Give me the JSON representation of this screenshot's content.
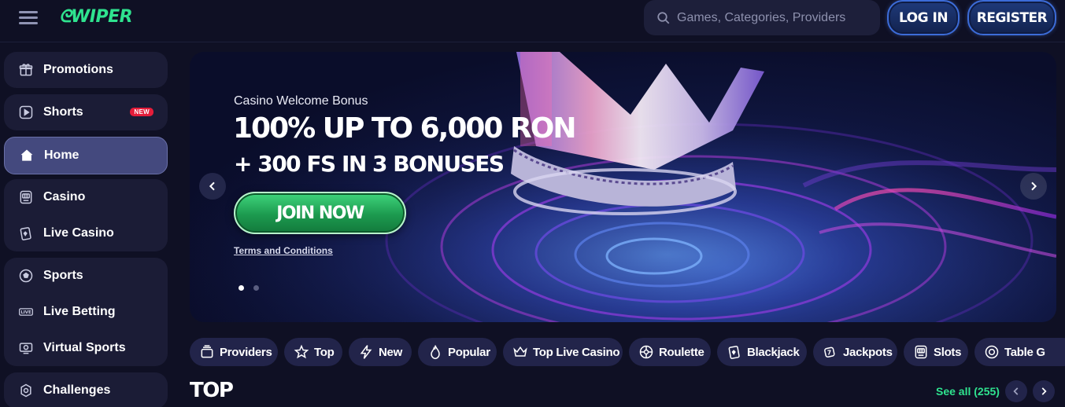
{
  "header": {
    "logo_text": "ᘓWIPER",
    "search_placeholder": "Games, Categories, Providers",
    "login_label": "LOG IN",
    "register_label": "REGISTER"
  },
  "sidebar": {
    "groups": [
      {
        "items": [
          {
            "label": "Promotions",
            "icon": "gift-icon"
          }
        ]
      },
      {
        "items": [
          {
            "label": "Shorts",
            "icon": "play-icon",
            "badge": "NEW"
          }
        ]
      },
      {
        "items": [
          {
            "label": "Home",
            "icon": "home-icon",
            "active": true
          }
        ]
      },
      {
        "items": [
          {
            "label": "Casino",
            "icon": "slot-machine-icon"
          },
          {
            "label": "Live Casino",
            "icon": "cards-icon"
          }
        ]
      },
      {
        "items": [
          {
            "label": "Sports",
            "icon": "soccer-ball-icon"
          },
          {
            "label": "Live Betting",
            "icon": "live-icon"
          },
          {
            "label": "Virtual Sports",
            "icon": "monitor-icon"
          }
        ]
      },
      {
        "items": [
          {
            "label": "Challenges",
            "icon": "badge-icon"
          }
        ]
      }
    ]
  },
  "banner": {
    "subtitle": "Casino Welcome Bonus",
    "title_line1": "100% UP TO 6,000 RON",
    "title_line2": "+ 300 FS IN 3 BONUSES",
    "cta_label": "JOIN NOW",
    "terms_label": "Terms and Conditions",
    "slides": 2,
    "active_slide": 1
  },
  "categories": [
    {
      "label": "Providers",
      "icon": "layers-icon"
    },
    {
      "label": "Top",
      "icon": "star-icon"
    },
    {
      "label": "New",
      "icon": "lightning-icon"
    },
    {
      "label": "Popular",
      "icon": "fire-icon"
    },
    {
      "label": "Top Live Casino",
      "icon": "crown-icon"
    },
    {
      "label": "Roulette",
      "icon": "roulette-icon"
    },
    {
      "label": "Blackjack",
      "icon": "cards-icon"
    },
    {
      "label": "Jackpots",
      "icon": "dice-icon"
    },
    {
      "label": "Slots",
      "icon": "slot-machine-icon"
    },
    {
      "label": "Table G",
      "icon": "chip-icon"
    }
  ],
  "section": {
    "title": "TOP",
    "see_all_label": "See all (255)"
  },
  "colors": {
    "background": "#0f1024",
    "accent_green": "#2fe38f",
    "sidebar_bg": "#1b1c36",
    "new_badge": "#e51d3a"
  }
}
